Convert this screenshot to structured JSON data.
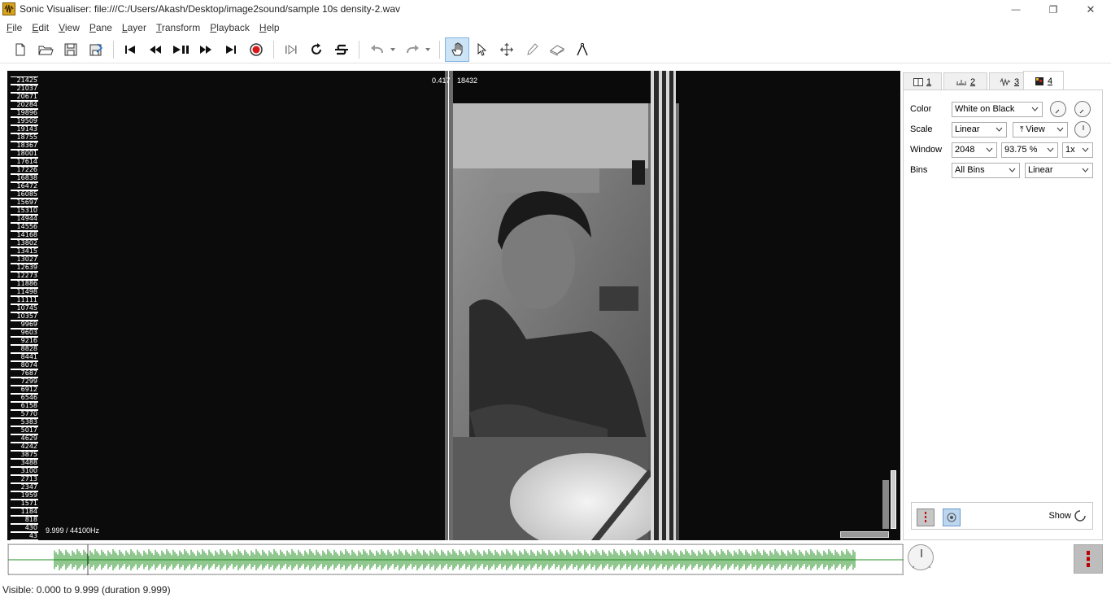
{
  "window": {
    "title": "Sonic Visualiser: file:///C:/Users/Akash/Desktop/image2sound/sample 10s density-2.wav",
    "minimize_glyph": "—",
    "maximize_glyph": "❐",
    "close_glyph": "✕"
  },
  "menu": [
    {
      "first": "F",
      "rest": "ile"
    },
    {
      "first": "E",
      "rest": "dit"
    },
    {
      "first": "V",
      "rest": "iew"
    },
    {
      "first": "P",
      "rest": "ane"
    },
    {
      "first": "L",
      "rest": "ayer"
    },
    {
      "first": "T",
      "rest": "ransform"
    },
    {
      "first": "P",
      "rest": "layback"
    },
    {
      "first": "H",
      "rest": "elp"
    }
  ],
  "toolbar_icons": [
    "new-file-icon",
    "open-folder-icon",
    "save-icon",
    "save-as-icon",
    "rewind-start-icon",
    "rewind-icon",
    "play-pause-icon",
    "fast-forward-icon",
    "forward-end-icon",
    "record-icon",
    "play-selection-icon",
    "loop-icon",
    "solo-icon",
    "undo-icon",
    "redo-icon",
    "navigate-tool-icon",
    "select-tool-icon",
    "move-tool-icon",
    "draw-tool-icon",
    "erase-tool-icon",
    "measure-tool-icon"
  ],
  "pane": {
    "scale_ticks": [
      "21425",
      "21037",
      "20671",
      "20284",
      "19896",
      "19509",
      "19143",
      "18755",
      "18367",
      "18001",
      "17614",
      "17226",
      "16838",
      "16472",
      "16085",
      "15697",
      "15310",
      "14944",
      "14556",
      "14168",
      "13802",
      "13415",
      "13027",
      "12639",
      "12273",
      "11886",
      "11498",
      "11111",
      "10745",
      "10357",
      "9969",
      "9603",
      "9216",
      "8828",
      "8441",
      "8074",
      "7687",
      "7299",
      "6912",
      "6546",
      "6158",
      "5770",
      "5383",
      "5017",
      "4629",
      "4242",
      "3875",
      "3488",
      "3100",
      "2713",
      "2347",
      "1959",
      "1571",
      "1184",
      "818",
      "430",
      "43"
    ],
    "cursor_time": "0.417",
    "cursor_freq": "18432",
    "freq_info": "9.999 / 44100Hz",
    "playhead_fraction": 0.417
  },
  "tabs": [
    {
      "num": "1",
      "icon": "pane-icon"
    },
    {
      "num": "2",
      "icon": "ruler-icon"
    },
    {
      "num": "3",
      "icon": "waveform-icon"
    },
    {
      "num": "4",
      "icon": "spectrogram-icon"
    }
  ],
  "props": {
    "color_label": "Color",
    "color_value": "White on Black",
    "scale_label": "Scale",
    "scale_value": "Linear",
    "view_value": "View",
    "window_label": "Window",
    "window_value": "2048",
    "overlap_value": "93.75 %",
    "oversample_value": "1x",
    "bins_label": "Bins",
    "bins_value": "All Bins",
    "bins_scale_value": "Linear",
    "show_label": "Show"
  },
  "status": {
    "visible_text": "Visible: 0.000 to 9.999 (duration 9.999)"
  },
  "colors": {
    "waveform": "#1f8f1f",
    "pane_bg": "#0b0b0b",
    "tab_active": "#ffffff"
  }
}
